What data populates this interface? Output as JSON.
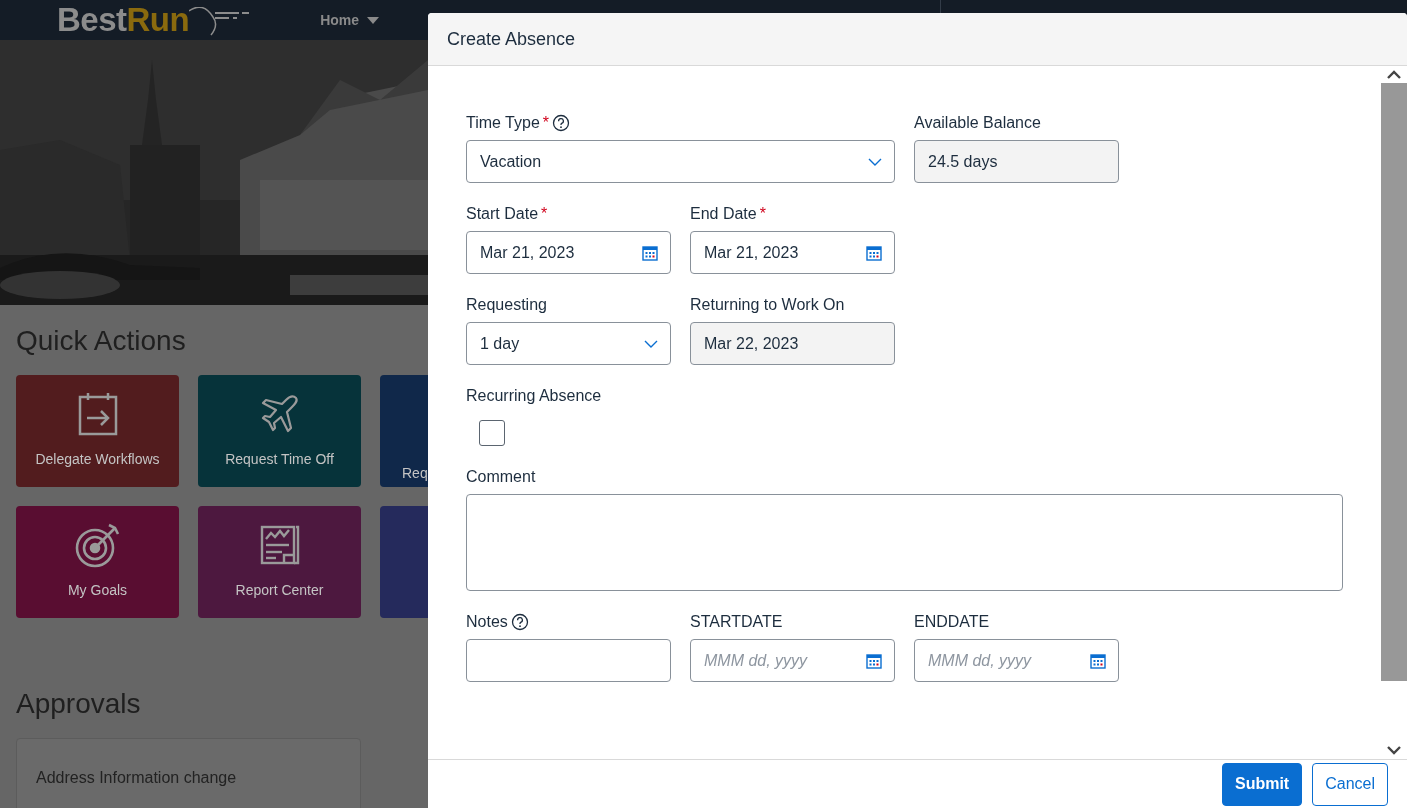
{
  "header": {
    "logo": {
      "first": "Best",
      "second": "Run"
    },
    "nav": "Home"
  },
  "quick_actions": {
    "title": "Quick Actions",
    "tiles": [
      {
        "label": "Delegate Workflows",
        "color": "#521c1e"
      },
      {
        "label": "Request Time Off",
        "color": "#06333a"
      },
      {
        "label": "Req",
        "color": "#10284a"
      },
      {
        "label": "My Goals",
        "color": "#590d31"
      },
      {
        "label": "Report Center",
        "color": "#4d183f"
      },
      {
        "color": "#252a5c"
      }
    ]
  },
  "approvals": {
    "title": "Approvals",
    "cards": [
      {
        "title": "Address Information change"
      }
    ]
  },
  "dialog": {
    "title": "Create Absence",
    "fields": [
      {
        "kind": "select",
        "label": "Time Type",
        "required_mark": "*",
        "help": true,
        "value": "Vacation"
      },
      {
        "kind": "readonly",
        "label": "Available Balance",
        "value": "24.5 days"
      },
      {
        "kind": "date",
        "label": "Start Date",
        "required_mark": "*",
        "value": "Mar 21, 2023"
      },
      {
        "kind": "date",
        "label": "End Date",
        "required_mark": "*",
        "value": "Mar 21, 2023"
      },
      {
        "kind": "select",
        "label": "Requesting",
        "value": "1 day"
      },
      {
        "kind": "readonly",
        "label": "Returning to Work On",
        "value": "Mar 22, 2023"
      },
      {
        "kind": "checkbox",
        "label": "Recurring Absence",
        "checked": false
      },
      {
        "kind": "textarea",
        "label": "Comment"
      },
      {
        "kind": "text",
        "label": "Notes",
        "help": true
      },
      {
        "kind": "date",
        "label": "STARTDATE",
        "placeholder": "MMM dd, yyyy"
      },
      {
        "kind": "date",
        "label": "ENDDATE",
        "placeholder": "MMM dd, yyyy"
      }
    ],
    "buttons": [
      {
        "label": "Submit",
        "kind": "primary"
      },
      {
        "label": "Cancel",
        "kind": "secondary"
      }
    ]
  }
}
